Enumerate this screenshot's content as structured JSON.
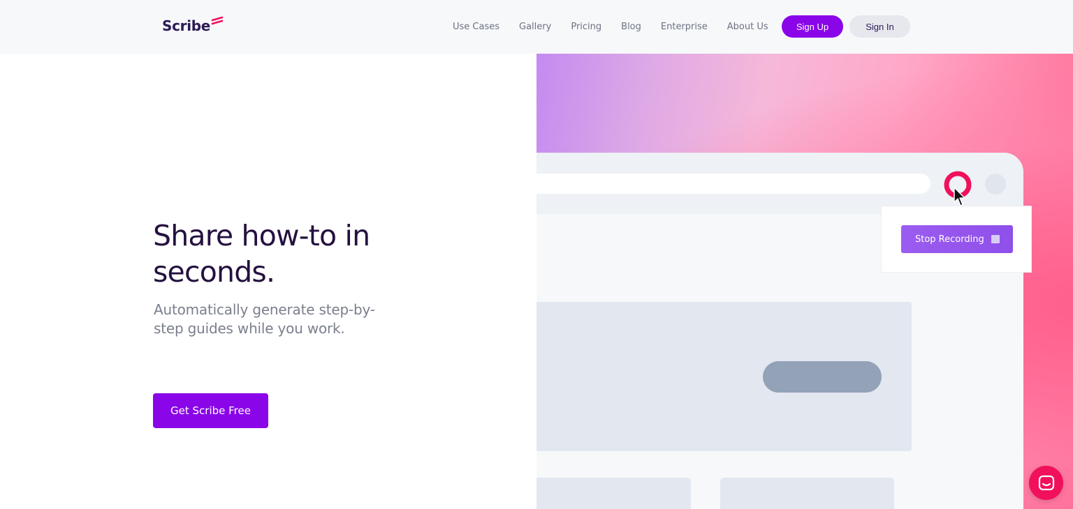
{
  "header": {
    "logo_text": "Scribe",
    "nav": [
      {
        "label": "Use Cases"
      },
      {
        "label": "Gallery"
      },
      {
        "label": "Pricing"
      },
      {
        "label": "Blog"
      },
      {
        "label": "Enterprise"
      },
      {
        "label": "About Us"
      }
    ],
    "sign_up_label": "Sign Up",
    "sign_in_label": "Sign In"
  },
  "hero": {
    "title": "Share how-to in seconds.",
    "subtitle": "Automatically generate step-by-step guides while you work.",
    "cta_label": "Get Scribe Free"
  },
  "mockup": {
    "stop_recording_label": "Stop Recording"
  },
  "colors": {
    "accent": "#8a05e8",
    "record": "#f0105b",
    "stop_button": "#9b5cf0",
    "chat_button": "#f0105b"
  },
  "icons": {
    "logo": "scribe-logo-icon",
    "record": "record-icon",
    "cursor": "cursor-icon",
    "stop": "stop-icon",
    "chat": "chat-icon"
  }
}
